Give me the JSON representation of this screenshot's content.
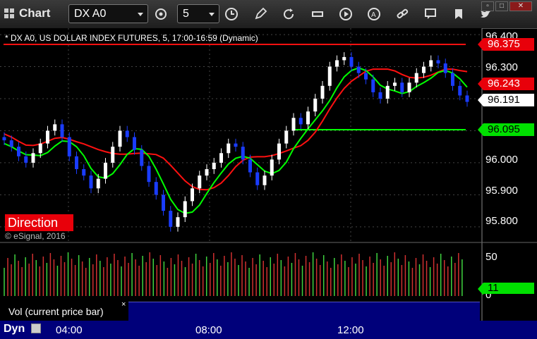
{
  "window": {
    "title": "Chart",
    "symbol_select": "DX A0",
    "interval_select": "5",
    "toolbar_icons": [
      "gear-icon",
      "clock-icon",
      "pencil-icon",
      "refresh-icon",
      "quote-icon",
      "play-icon",
      "alert-icon",
      "link-icon",
      "comment-icon",
      "bookmark-icon",
      "twitter-icon"
    ]
  },
  "chart": {
    "header": "* DX A0, US DOLLAR INDEX FUTURES, 5, 17:00-16:59 (Dynamic)",
    "direction_label": "Direction",
    "copyright": "© eSignal, 2016",
    "y_ticks": [
      "96.400",
      "96.300",
      "96.000",
      "95.900",
      "95.800"
    ],
    "price_tags": {
      "upper_band": "96.375",
      "red_ma": "96.243",
      "last_price": "96.191",
      "green_ma": "96.095"
    },
    "colors": {
      "up": "#ffffff",
      "down": "#1a3cff",
      "red_line": "#ff1010",
      "green_line": "#00ff00"
    }
  },
  "volume": {
    "legend": "Vol (current price bar)",
    "close_symbol": "×",
    "y_ticks": [
      "50",
      "0"
    ],
    "current_value": "11"
  },
  "footer": {
    "mode": "Dyn",
    "x_ticks": [
      "04:00",
      "08:00",
      "12:00"
    ]
  },
  "chart_data": {
    "type": "candlestick",
    "title": "* DX A0, US DOLLAR INDEX FUTURES, 5, 17:00-16:59 (Dynamic)",
    "x_ticks": [
      "04:00",
      "08:00",
      "12:00"
    ],
    "ylim": [
      95.76,
      96.42
    ],
    "series": [
      {
        "name": "",
        "type": "line",
        "color": "#ff1010",
        "x": [
          0,
          10,
          20,
          25,
          40,
          45,
          55,
          60,
          75,
          84,
          95,
          110,
          125,
          130,
          137,
          140
        ],
        "y": [
          96.375,
          96.375,
          96.375,
          96.375,
          96.375,
          96.375,
          96.375,
          96.375,
          96.375,
          96.375,
          96.375,
          96.375,
          96.375,
          96.375,
          96.375,
          96.375
        ]
      },
      {
        "name": "",
        "type": "line",
        "color": "#00ff00",
        "x": [
          84,
          95,
          110,
          125,
          140
        ],
        "y": [
          96.095,
          96.095,
          96.095,
          96.095,
          96.095
        ]
      }
    ],
    "closes": [
      96.07,
      96.05,
      96.02,
      96.0,
      96.03,
      96.06,
      96.1,
      96.12,
      96.08,
      96.02,
      95.98,
      95.96,
      95.92,
      95.95,
      96.0,
      96.05,
      96.1,
      96.08,
      96.04,
      95.99,
      95.94,
      95.9,
      95.85,
      95.8,
      95.83,
      95.88,
      95.92,
      95.96,
      95.98,
      96.0,
      96.03,
      96.06,
      96.05,
      96.01,
      95.97,
      95.93,
      95.96,
      96.01,
      96.06,
      96.1,
      96.14,
      96.12,
      96.16,
      96.2,
      96.24,
      96.3,
      96.32,
      96.33,
      96.3,
      96.28,
      96.26,
      96.22,
      96.2,
      96.24,
      96.25,
      96.22,
      96.25,
      96.28,
      96.3,
      96.32,
      96.31,
      96.28,
      96.24,
      96.21,
      96.19
    ]
  }
}
